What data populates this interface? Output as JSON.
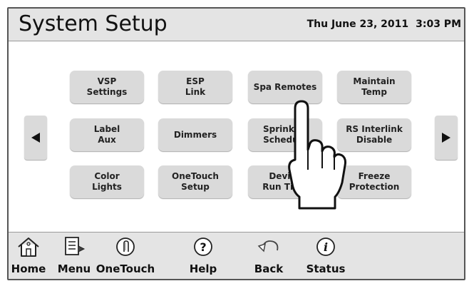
{
  "header": {
    "title": "System Setup",
    "date": "Thu June 23, 2011",
    "time": "3:03 PM"
  },
  "grid": {
    "row1": [
      "VSP\nSettings",
      "ESP\nLink",
      "Spa Remotes",
      "Maintain\nTemp"
    ],
    "row2": [
      "Label\nAux",
      "Dimmers",
      "Sprinkler\nSchedule",
      "RS Interlink\nDisable"
    ],
    "row3": [
      "Color\nLights",
      "OneTouch\nSetup",
      "Device\nRun Time",
      "Freeze\nProtection"
    ]
  },
  "arrows": {
    "prev_icon": "left-triangle-icon",
    "next_icon": "right-triangle-icon"
  },
  "footer": {
    "home_label": "Home",
    "menu_label": "Menu",
    "onetouch_label": "OneTouch",
    "help_label": "Help",
    "back_label": "Back",
    "status_label": "Status"
  },
  "colors": {
    "header_bg": "#e4e4e4",
    "button_bg": "#dadada",
    "border": "#555555"
  }
}
